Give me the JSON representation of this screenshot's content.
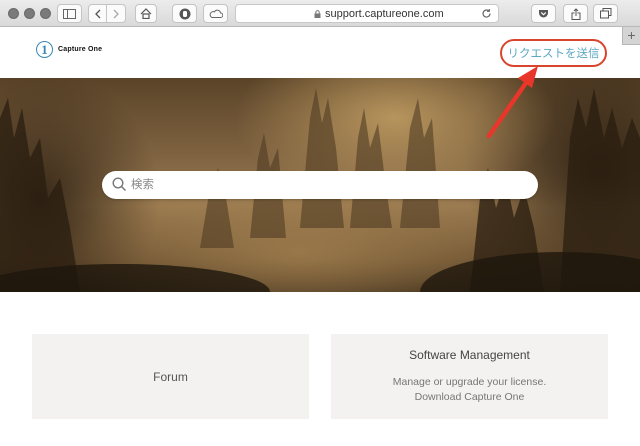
{
  "browser": {
    "url": "support.captureone.com",
    "new_tab_symbol": "+"
  },
  "header": {
    "logo_text": "Capture One",
    "logo_mark": "1",
    "submit_request_label": "リクエストを送信"
  },
  "hero": {
    "search_placeholder": "検索",
    "search_value": ""
  },
  "cards": {
    "forum": {
      "title": "Forum"
    },
    "software": {
      "title": "Software Management",
      "lines": [
        "Manage or upgrade your license.",
        "Download Capture One"
      ]
    }
  },
  "annotation": {
    "arrow_color": "#e8372a",
    "highlight_color": "#d9442d"
  },
  "colors": {
    "link": "#5ea8c4",
    "logo": "#3a86b5",
    "card_bg": "#f3f2f1"
  }
}
